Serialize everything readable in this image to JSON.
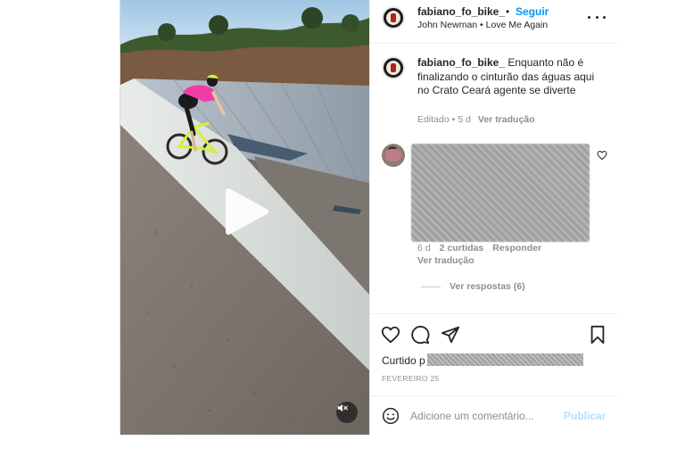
{
  "post": {
    "username": "fabiano_fo_bike_",
    "separator": "•",
    "follow_label": "Seguir",
    "audio": {
      "artist": "John Newman",
      "separator": "•",
      "track": "Love Me Again"
    },
    "caption": {
      "username": "fabiano_fo_bike_",
      "text": "Enquanto não é finalizando o cinturão das águas aqui no Crato Ceará agente se diverte",
      "edited": "Editado",
      "separator": "•",
      "age": "5 d",
      "translate_label": "Ver tradução"
    },
    "comment": {
      "age": "6 d",
      "likes": "2 curtidas",
      "reply_label": "Responder",
      "translate_label": "Ver tradução",
      "view_replies_label": "Ver respostas (6)"
    },
    "liked_by_prefix": "Curtido p",
    "date": "FEVEREIRO 25",
    "comment_box": {
      "placeholder": "Adicione um comentário...",
      "publish_label": "Publicar"
    }
  },
  "colors": {
    "accent": "#0095f6",
    "publish_disabled": "#b2dffc",
    "muted_text": "#8e8e8e",
    "rider_jersey": "#f03ca8",
    "bike_frame": "#d4ef3a"
  },
  "icons": {
    "play": "play-icon",
    "mute": "muted-speaker-icon",
    "more": "more-options-icon",
    "like": "heart-icon",
    "comment": "comment-bubble-icon",
    "share": "paper-plane-icon",
    "save": "bookmark-icon",
    "emoji": "emoji-smile-icon"
  }
}
